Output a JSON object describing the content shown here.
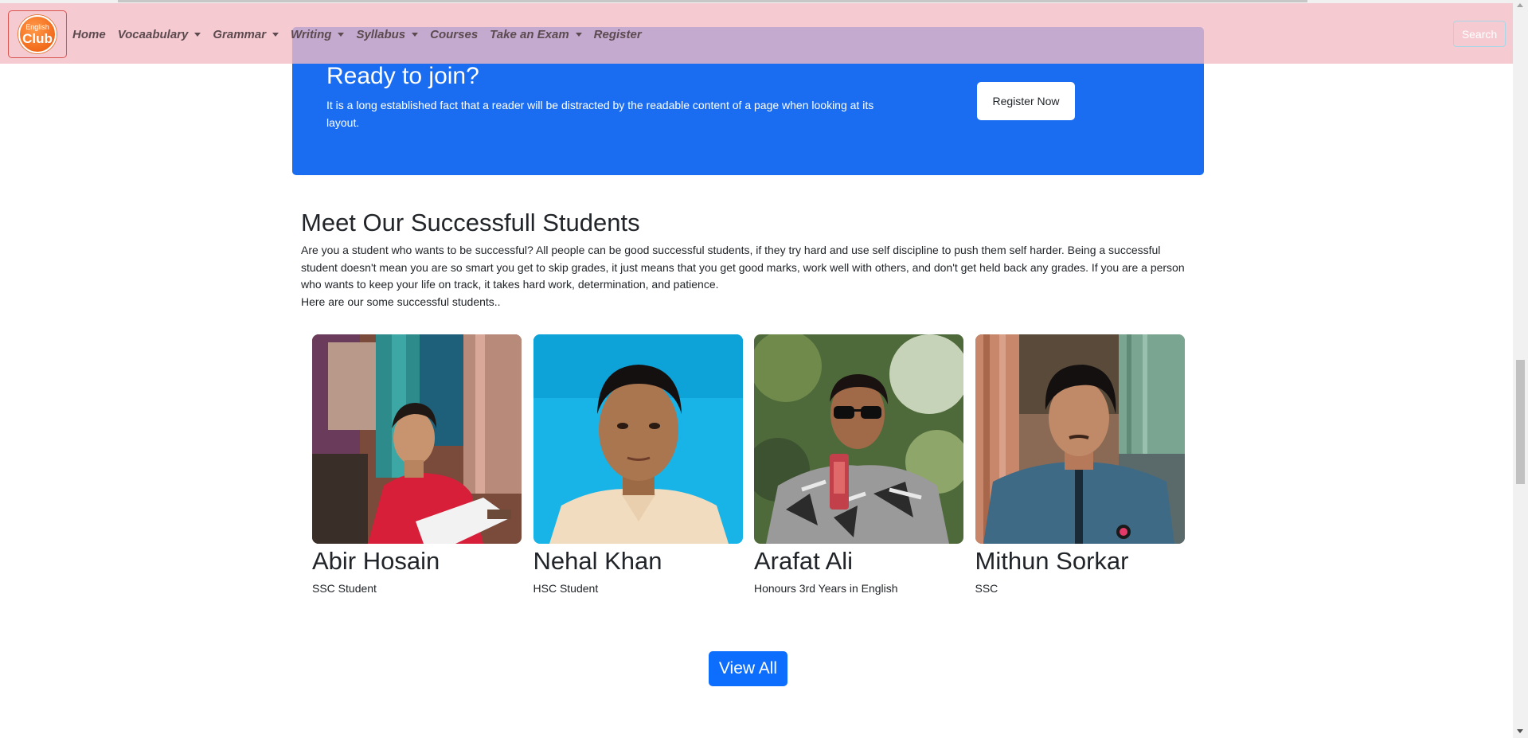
{
  "brand": {
    "logo_line1": "English",
    "logo_line2": "Club"
  },
  "nav": {
    "items": [
      {
        "label": "Home",
        "dropdown": false
      },
      {
        "label": "Vocaabulary",
        "dropdown": true
      },
      {
        "label": "Grammar",
        "dropdown": true
      },
      {
        "label": "Writing",
        "dropdown": true
      },
      {
        "label": "Syllabus",
        "dropdown": true
      },
      {
        "label": "Courses",
        "dropdown": false
      },
      {
        "label": "Take an Exam",
        "dropdown": true
      },
      {
        "label": "Register",
        "dropdown": false
      }
    ],
    "search_label": "Search"
  },
  "join": {
    "title": "Ready to join?",
    "text": "It is a long established fact that a reader will be distracted by the readable content of a page when looking at its layout.",
    "button": "Register Now"
  },
  "students": {
    "title": "Meet Our Successfull Students",
    "description": "Are you a student who wants to be successful? All people can be good successful students, if they try hard and use self discipline to push them self harder. Being a successful student doesn't mean you are so smart you get to skip grades, it just means that you get good marks, work well with others, and don't get held back any grades. If you are a person who wants to keep your life on track, it takes hard work, determination, and patience.",
    "subtext": "Here are our some successful students..",
    "list": [
      {
        "name": "Abir Hosain",
        "role": "SSC Student"
      },
      {
        "name": "Nehal Khan",
        "role": "HSC Student"
      },
      {
        "name": "Arafat Ali",
        "role": "Honours 3rd Years in English"
      },
      {
        "name": "Mithun Sorkar",
        "role": "SSC"
      }
    ],
    "view_all": "View All"
  },
  "colors": {
    "navbar_bg": "#f4bbc4",
    "banner_blue": "#1a6cf0",
    "button_blue": "#0d6efd",
    "logo_orange": "#f26a1b"
  }
}
